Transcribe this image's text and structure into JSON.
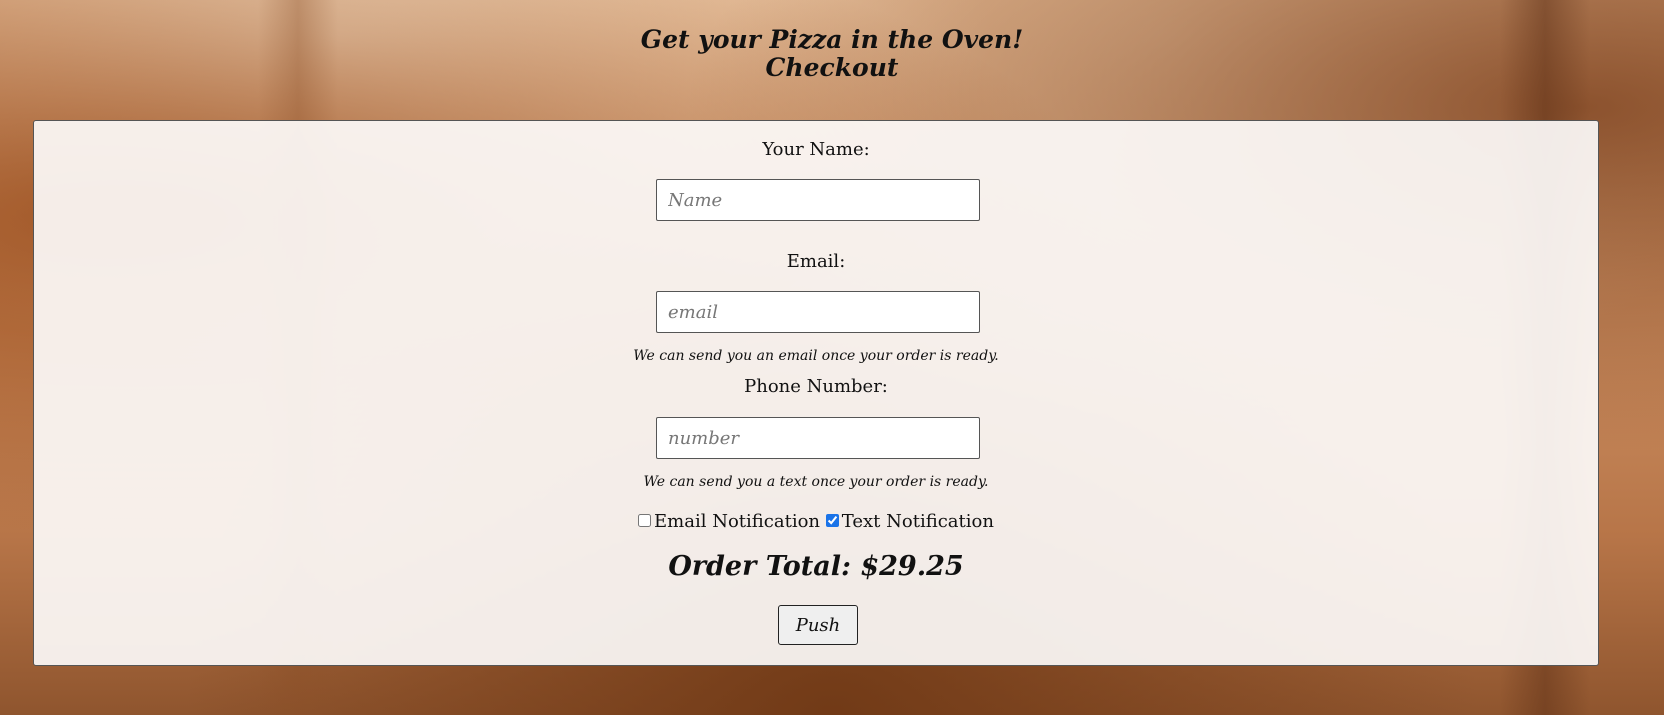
{
  "header": {
    "title": "Get your Pizza in the Oven!",
    "subtitle": "Checkout"
  },
  "form": {
    "name_label": "Your Name:",
    "name_placeholder": "Name",
    "email_label": "Email:",
    "email_placeholder": "email",
    "email_help": "We can send you an email once your order is ready.",
    "phone_label": "Phone Number:",
    "phone_placeholder": "number",
    "phone_help": "We can send you a text once your order is ready.",
    "email_notification_label": "Email Notification",
    "email_notification_checked": false,
    "text_notification_label": "Text Notification",
    "text_notification_checked": true,
    "order_total": "Order Total: $29.25",
    "submit_label": "Push"
  },
  "colors": {
    "checkbox_accent": "#1a73e8",
    "panel_background": "#fcfaf8"
  }
}
